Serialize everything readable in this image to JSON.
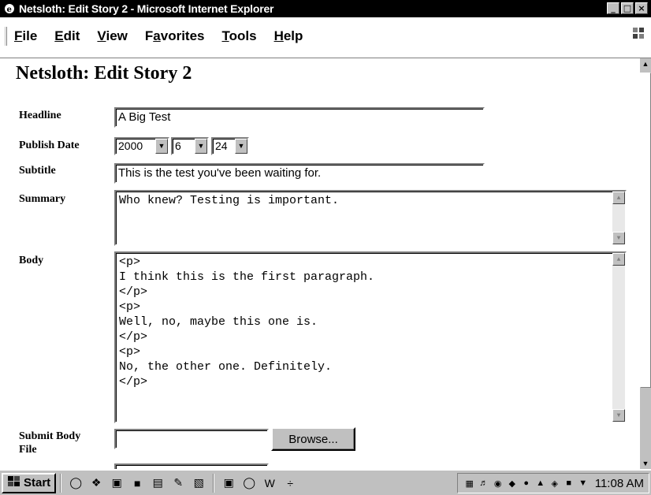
{
  "window": {
    "title": "Netsloth: Edit Story 2 - Microsoft Internet Explorer",
    "controls": [
      "_",
      "8",
      "x"
    ]
  },
  "menu": {
    "items": [
      {
        "key": "F",
        "rest": "ile"
      },
      {
        "key": "E",
        "rest": "dit"
      },
      {
        "key": "V",
        "rest": "iew"
      },
      {
        "key": "a",
        "pre": "F",
        "rest": "vorites"
      },
      {
        "key": "T",
        "rest": "ools"
      },
      {
        "key": "H",
        "rest": "elp"
      }
    ]
  },
  "page": {
    "title": "Netsloth: Edit Story 2",
    "labels": {
      "headline": "Headline",
      "publish_date": "Publish Date",
      "subtitle": "Subtitle",
      "summary": "Summary",
      "body": "Body",
      "submit_body_file": "Submit Body\nFile"
    },
    "fields": {
      "headline": "A Big Test",
      "publish_year": "2000",
      "publish_month": "6",
      "publish_day": "24",
      "subtitle": "This is the test you've been waiting for.",
      "summary": "Who knew? Testing is important.",
      "body": "<p>\nI think this is the first paragraph.\n</p>\n<p>\nWell, no, maybe this one is.\n</p>\n<p>\nNo, the other one. Definitely.\n</p>",
      "submit_body_file": ""
    },
    "browse_button": "Browse..."
  },
  "taskbar": {
    "start_label": "Start",
    "clock": "11:08 AM"
  }
}
